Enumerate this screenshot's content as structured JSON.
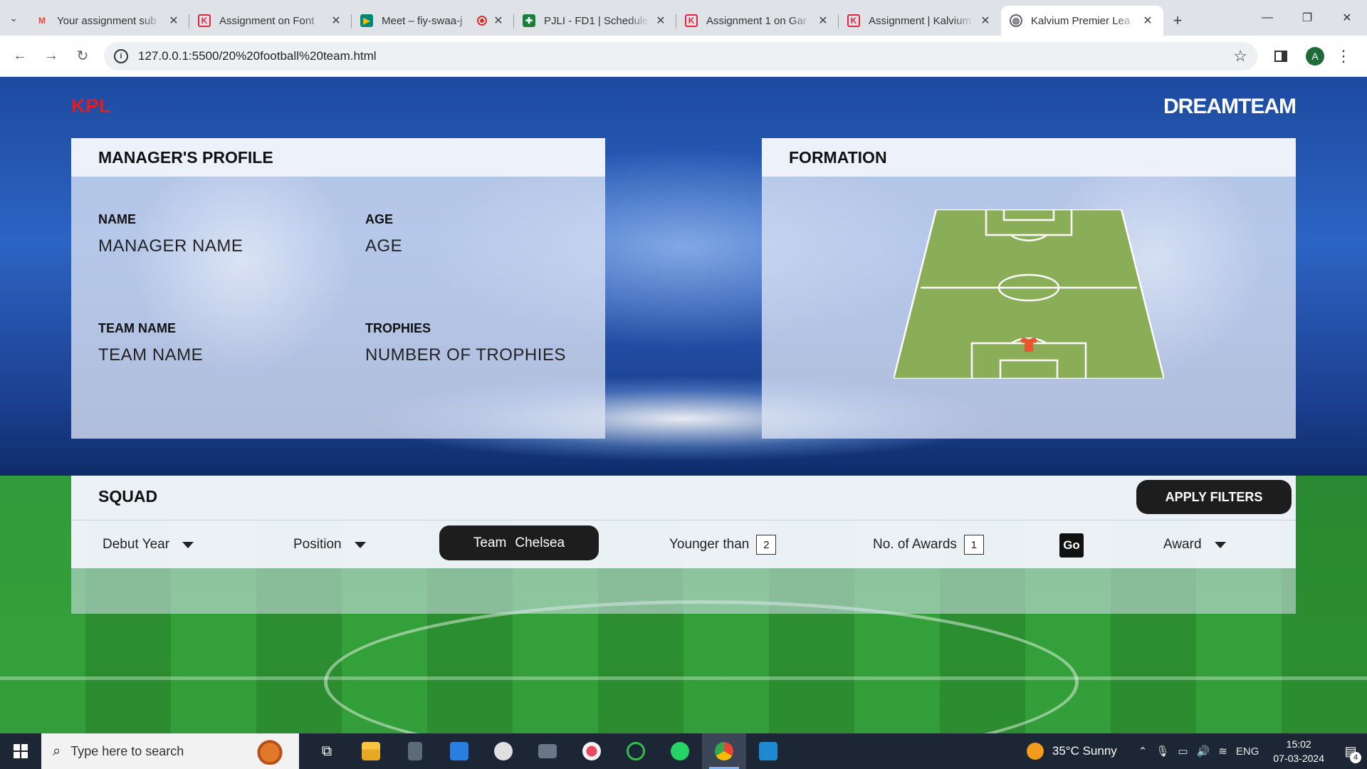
{
  "browser": {
    "tabs": [
      {
        "title": "Your assignment sub",
        "icon": "gmail-icon",
        "color": "#ea4335"
      },
      {
        "title": "Assignment on Font",
        "icon": "kalvium-icon",
        "color": "#e2253d"
      },
      {
        "title": "Meet – fiy-swaa-j",
        "icon": "meet-icon",
        "color": "#00897b"
      },
      {
        "title": "PJLI - FD1 | Schedule",
        "icon": "sheets-icon",
        "color": "#188038"
      },
      {
        "title": "Assignment 1 on Gar",
        "icon": "kalvium-icon",
        "color": "#e2253d"
      },
      {
        "title": "Assignment | Kalvium",
        "icon": "kalvium-icon",
        "color": "#e2253d"
      },
      {
        "title": "Kalvium Premier Lea",
        "icon": "globe-icon",
        "color": "#5f6368"
      }
    ],
    "url": "127.0.0.1:5500/20%20football%20team.html"
  },
  "page": {
    "brand_left": "KPL",
    "brand_right": "DREAMTEAM",
    "profile": {
      "title": "MANAGER'S PROFILE",
      "name_label": "NAME",
      "name_value": "MANAGER NAME",
      "age_label": "AGE",
      "age_value": "AGE",
      "team_label": "TEAM NAME",
      "team_value": "TEAM NAME",
      "trophies_label": "TROPHIES",
      "trophies_value": "NUMBER OF TROPHIES"
    },
    "formation": {
      "title": "FORMATION"
    },
    "squad": {
      "title": "SQUAD",
      "apply_filters": "APPLY FILTERS",
      "debut_year": "Debut Year",
      "position": "Position",
      "team_label": "Team",
      "team_value": "Chelsea",
      "younger_than": "Younger than",
      "younger_value": "2",
      "awards_label": "No. of Awards",
      "awards_value": "1",
      "go": "Go",
      "award": "Award"
    }
  },
  "taskbar": {
    "search_placeholder": "Type here to search",
    "weather": "35°C  Sunny",
    "lang": "ENG",
    "time": "15:02",
    "date": "07-03-2024",
    "notifications": "4"
  },
  "colors": {
    "brand_red": "#e31b23",
    "pitch_green": "#8aad58",
    "dark_button": "#1d1d1d"
  }
}
